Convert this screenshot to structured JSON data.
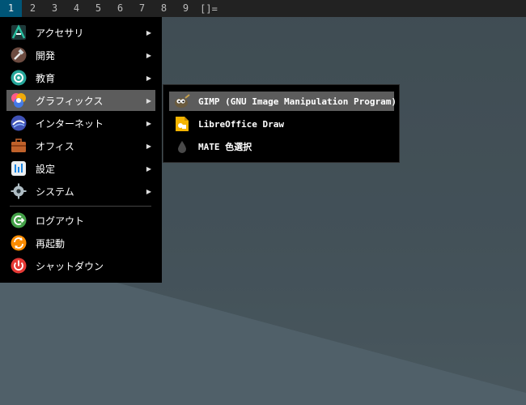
{
  "topbar": {
    "workspaces": [
      "1",
      "2",
      "3",
      "4",
      "5",
      "6",
      "7",
      "8",
      "9"
    ],
    "active_workspace": "1",
    "layout_symbol": "[]="
  },
  "menu": {
    "items": [
      {
        "label": "アクセサリ",
        "icon": "accessories-icon",
        "has_submenu": true
      },
      {
        "label": "開発",
        "icon": "development-icon",
        "has_submenu": true
      },
      {
        "label": "教育",
        "icon": "education-icon",
        "has_submenu": true
      },
      {
        "label": "グラフィックス",
        "icon": "graphics-icon",
        "has_submenu": true,
        "active": true
      },
      {
        "label": "インターネット",
        "icon": "internet-icon",
        "has_submenu": true
      },
      {
        "label": "オフィス",
        "icon": "office-icon",
        "has_submenu": true
      },
      {
        "label": "設定",
        "icon": "settings-icon",
        "has_submenu": true
      },
      {
        "label": "システム",
        "icon": "system-icon",
        "has_submenu": true
      }
    ],
    "session_items": [
      {
        "label": "ログアウト",
        "icon": "logout-icon"
      },
      {
        "label": "再起動",
        "icon": "restart-icon"
      },
      {
        "label": "シャットダウン",
        "icon": "shutdown-icon"
      }
    ],
    "arrow": "▶"
  },
  "submenu": {
    "items": [
      {
        "label": "GIMP (GNU Image Manipulation Program)",
        "icon": "gimp-icon",
        "active": true
      },
      {
        "label": "LibreOffice Draw",
        "icon": "libreoffice-draw-icon"
      },
      {
        "label": "MATE 色選択",
        "icon": "color-picker-icon"
      }
    ]
  },
  "colors": {
    "topbar_bg": "#222222",
    "active_workspace_bg": "#005577",
    "menu_bg": "#000000",
    "highlight_bg": "#5c5c5c"
  }
}
